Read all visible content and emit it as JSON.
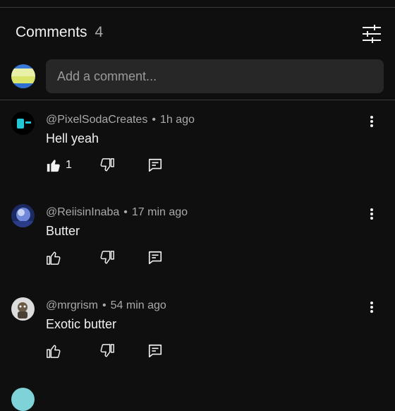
{
  "header": {
    "title": "Comments",
    "count": "4"
  },
  "composer": {
    "placeholder": "Add a comment..."
  },
  "comments": [
    {
      "author": "@PixelSodaCreates",
      "time": "1h ago",
      "text": "Hell yeah",
      "likes": "1",
      "liked": true
    },
    {
      "author": "@ReiisinInaba",
      "time": "17 min ago",
      "text": "Butter",
      "likes": "",
      "liked": false
    },
    {
      "author": "@mrgrism",
      "time": "54 min ago",
      "text": "Exotic butter",
      "likes": "",
      "liked": false
    }
  ],
  "colors": {
    "background": "#0f0f0f",
    "input_bg": "#272727",
    "text_primary": "#f1f1f1",
    "text_secondary": "#aaaaaa"
  },
  "icons": {
    "filter": "sliders-icon",
    "like": "thumbs-up-icon",
    "dislike": "thumbs-down-icon",
    "reply": "reply-comment-icon",
    "more": "more-vert-icon"
  }
}
